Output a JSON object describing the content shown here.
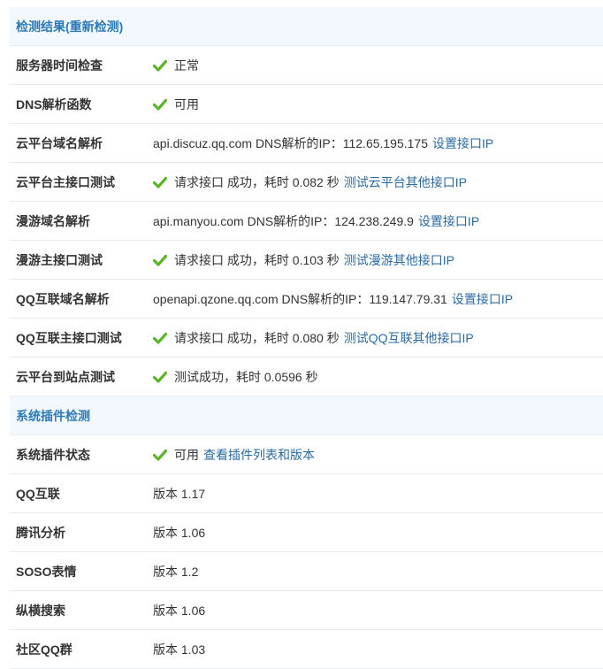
{
  "sections": [
    {
      "title": "检测结果(重新检测)",
      "rows": [
        {
          "name": "server-time-check",
          "label": "服务器时间检查",
          "check": true,
          "text": "正常",
          "link": ""
        },
        {
          "name": "dns-function",
          "label": "DNS解析函数",
          "check": true,
          "text": "可用",
          "link": ""
        },
        {
          "name": "cloud-domain",
          "label": "云平台域名解析",
          "check": false,
          "text": "api.discuz.qq.com DNS解析的IP：112.65.195.175",
          "link": "设置接口IP"
        },
        {
          "name": "cloud-main-api",
          "label": "云平台主接口测试",
          "check": true,
          "text": "请求接口 成功，耗时 0.082 秒",
          "link": "测试云平台其他接口IP"
        },
        {
          "name": "manyou-domain",
          "label": "漫游域名解析",
          "check": false,
          "text": "api.manyou.com DNS解析的IP：124.238.249.9",
          "link": "设置接口IP"
        },
        {
          "name": "manyou-main-api",
          "label": "漫游主接口测试",
          "check": true,
          "text": "请求接口 成功，耗时 0.103 秒",
          "link": "测试漫游其他接口IP"
        },
        {
          "name": "qq-connect-domain",
          "label": "QQ互联域名解析",
          "check": false,
          "text": "openapi.qzone.qq.com DNS解析的IP：119.147.79.31",
          "link": "设置接口IP"
        },
        {
          "name": "qq-connect-main-api",
          "label": "QQ互联主接口测试",
          "check": true,
          "text": "请求接口 成功，耗时 0.080 秒",
          "link": "测试QQ互联其他接口IP"
        },
        {
          "name": "cloud-to-site",
          "label": "云平台到站点测试",
          "check": true,
          "text": "测试成功，耗时 0.0596 秒",
          "link": ""
        }
      ]
    },
    {
      "title": "系统插件检测",
      "rows": [
        {
          "name": "plugin-status",
          "label": "系统插件状态",
          "check": true,
          "text": "可用",
          "link": "查看插件列表和版本"
        },
        {
          "name": "qq-connect",
          "label": "QQ互联",
          "check": false,
          "text": "版本 1.17",
          "link": ""
        },
        {
          "name": "tencent-analysis",
          "label": "腾讯分析",
          "check": false,
          "text": "版本 1.06",
          "link": ""
        },
        {
          "name": "soso-emoji",
          "label": "SOSO表情",
          "check": false,
          "text": "版本 1.2",
          "link": ""
        },
        {
          "name": "zongheng-search",
          "label": "纵横搜索",
          "check": false,
          "text": "版本 1.06",
          "link": ""
        },
        {
          "name": "community-qq-group",
          "label": "社区QQ群",
          "check": false,
          "text": "版本 1.03",
          "link": ""
        }
      ]
    }
  ],
  "colors": {
    "accent": "#2b7ab8",
    "link": "#2b6aa0",
    "check": "#5bb42a",
    "header_bg": "#f2f8fe"
  },
  "icons": {
    "check": "check-icon"
  }
}
